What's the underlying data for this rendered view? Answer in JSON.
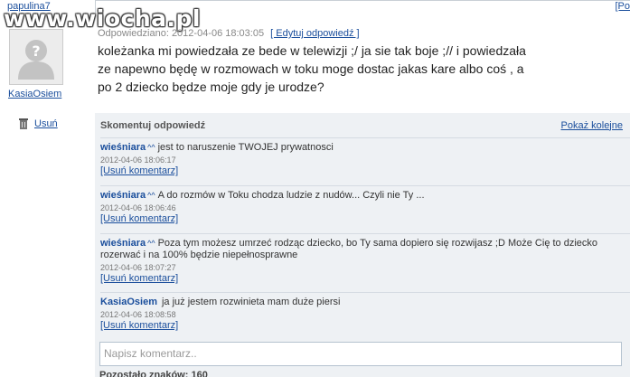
{
  "top": {
    "username": "papulina7",
    "right_link": "[Po"
  },
  "watermark": {
    "text": "www.wiocha.pl"
  },
  "answer": {
    "author": "KasiaOsiem",
    "delete_label": "Usuń",
    "meta": "Odpowiedziano: 2012-04-06 18:03:05",
    "edit_label": "[ Edytuj odpowiedź ]",
    "text": "koleżanka mi powiedzała ze bede w telewizji ;/ ja sie tak boje ;// i powiedzała ze napewno będę w rozmowach w toku moge dostac jakas kare albo coś , a po 2 dziecko będze moje gdy je urodze?"
  },
  "comments": {
    "title": "Skomentuj odpowiedź",
    "more_label": "Pokaż kolejne",
    "items": [
      {
        "author": "wieśniara",
        "sup": "^^",
        "text": "jest to naruszenie TWOJEJ prywatnosci",
        "date": "2012-04-06 18:06:17",
        "delete_label": "[Usuń komentarz]"
      },
      {
        "author": "wieśniara",
        "sup": "^^",
        "text": "A do rozmów w Toku chodza ludzie z nudów... Czyli nie Ty ...",
        "date": "2012-04-06 18:06:46",
        "delete_label": "[Usuń komentarz]"
      },
      {
        "author": "wieśniara",
        "sup": "^^",
        "text": "Poza tym możesz umrzeć rodząc dziecko, bo Ty sama dopiero się rozwijasz ;D Może Cię to dziecko rozerwać i na 100% będzie niepełnosprawne",
        "date": "2012-04-06 18:07:27",
        "delete_label": "[Usuń komentarz]"
      },
      {
        "author": "KasiaOsiem",
        "sup": "",
        "text": "ja już jestem rozwinieta mam duże piersi",
        "date": "2012-04-06 18:08:58",
        "delete_label": "[Usuń komentarz]"
      }
    ],
    "input_placeholder": "Napisz komentarz..",
    "remaining_label": "Pozostało znaków: 160"
  },
  "icons": {
    "avatar": "default-avatar-icon",
    "delete": "trash-icon"
  },
  "colors": {
    "link": "#1a4e9c",
    "comments_bg": "#eef1f4"
  }
}
